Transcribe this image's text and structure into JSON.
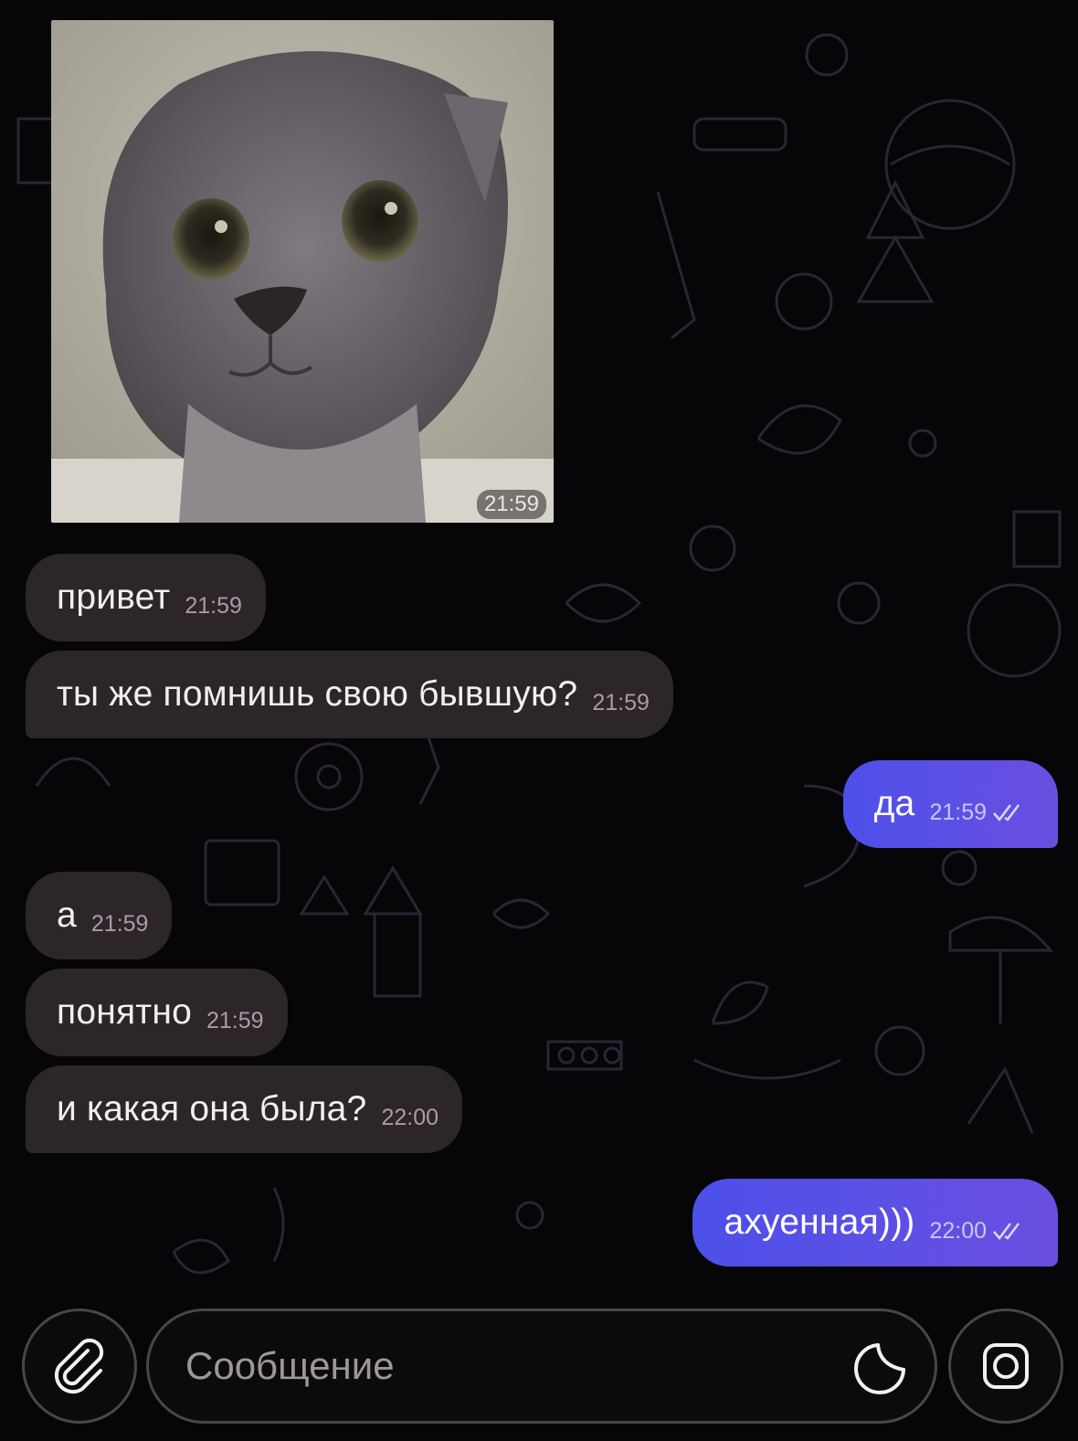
{
  "photo_message": {
    "time": "21:59"
  },
  "messages": [
    {
      "text": "привет",
      "time": "21:59"
    },
    {
      "text": "ты же помнишь свою бывшую?",
      "time": "21:59"
    },
    {
      "text": "да",
      "time": "21:59",
      "status": "read"
    },
    {
      "text": "а",
      "time": "21:59"
    },
    {
      "text": "понятно",
      "time": "21:59"
    },
    {
      "text": "и какая она была?",
      "time": "22:00"
    },
    {
      "text": "ахуенная)))",
      "time": "22:00",
      "status": "read"
    }
  ],
  "composer": {
    "placeholder": "Сообщение",
    "attach_icon": "paperclip-icon",
    "sticker_icon": "sticker-icon",
    "camera_icon": "camera-icon"
  },
  "colors": {
    "background": "#060507",
    "incoming_bubble": "#2c252a",
    "outgoing_bubble": "#5a50e6"
  }
}
